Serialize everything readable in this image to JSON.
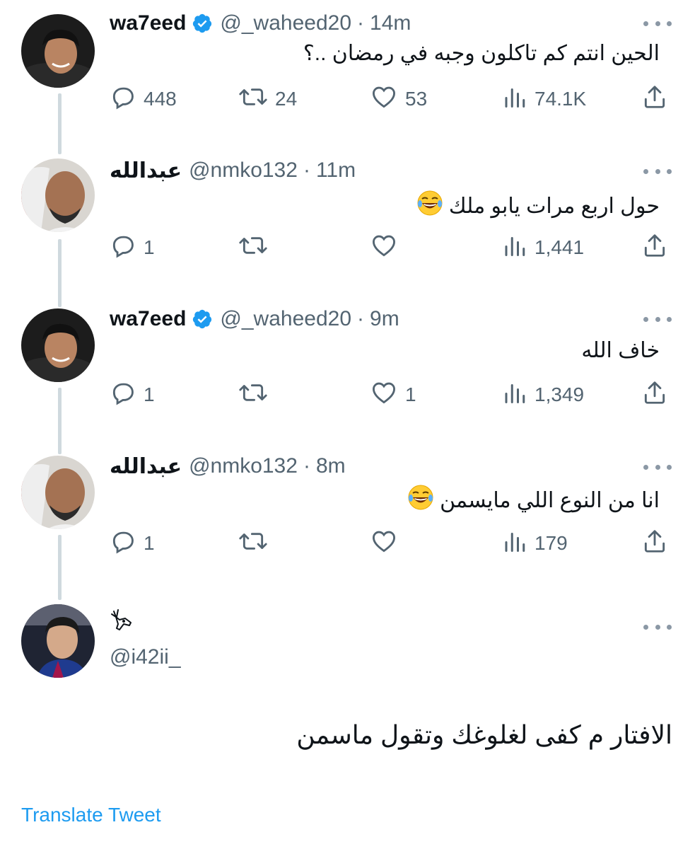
{
  "colors": {
    "accent": "#1d9bf0",
    "secondary": "#536471",
    "text": "#0f1419",
    "thread_line": "#cfd9de"
  },
  "tweets": [
    {
      "name": "wa7eed",
      "verified": true,
      "handle": "@_waheed20",
      "dot": "·",
      "time": "14m",
      "text": "الحين انتم كم تاكلون وجبه في رمضان ..؟",
      "emoji": "",
      "reply_count": "448",
      "retweet_count": "24",
      "like_count": "53",
      "view_count": "74.1K",
      "icons": [
        "reply-icon",
        "retweet-icon",
        "like-icon",
        "views-icon",
        "share-icon"
      ]
    },
    {
      "name": "عبدالله",
      "verified": false,
      "handle": "@nmko132",
      "dot": "·",
      "time": "11m",
      "text": "حول اربع مرات يابو ملك",
      "emoji": "😂",
      "reply_count": "1",
      "retweet_count": "",
      "like_count": "",
      "view_count": "1,441"
    },
    {
      "name": "wa7eed",
      "verified": true,
      "handle": "@_waheed20",
      "dot": "·",
      "time": "9m",
      "text": "خاف الله",
      "emoji": "",
      "reply_count": "1",
      "retweet_count": "",
      "like_count": "1",
      "view_count": "1,349"
    },
    {
      "name": "عبدالله",
      "verified": false,
      "handle": "@nmko132",
      "dot": "·",
      "time": "8m",
      "text": "انا من النوع اللي مايسمن",
      "emoji": "😂",
      "reply_count": "1",
      "retweet_count": "",
      "like_count": "",
      "view_count": "179"
    }
  ],
  "main_tweet": {
    "name_icon": "deer-icon",
    "handle": "@i42ii_",
    "text": "الافتار م كفى لغلوغك وتقول ماسمن"
  },
  "translate_label": "Translate Tweet"
}
